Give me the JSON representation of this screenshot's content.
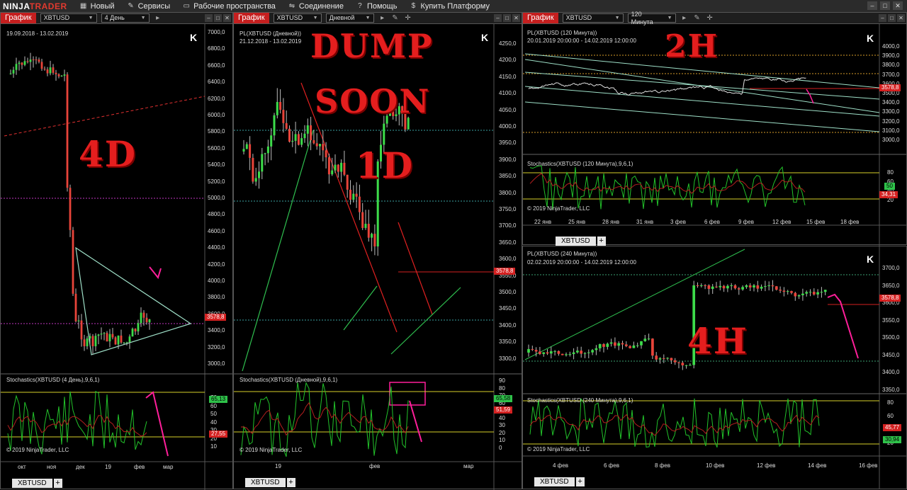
{
  "app": {
    "logo_prefix": "NINJA",
    "logo_suffix": "TRADER",
    "menu": [
      {
        "label": "Новый",
        "icon": "new-icon"
      },
      {
        "label": "Сервисы",
        "icon": "tools-icon"
      },
      {
        "label": "Рабочие пространства",
        "icon": "workspace-icon"
      },
      {
        "label": "Соединение",
        "icon": "connection-icon"
      },
      {
        "label": "Помощь",
        "icon": "help-icon"
      },
      {
        "label": "Купить Платформу",
        "icon": "dollar-icon"
      }
    ]
  },
  "panels": {
    "p4d": {
      "tab": "График",
      "instrument": "XBTUSD",
      "interval": "4 День",
      "range": "19.09.2018 - 13.02.2019",
      "price_ticks": [
        "7000,0",
        "6800,0",
        "6600,0",
        "6400,0",
        "6200,0",
        "6000,0",
        "5800,0",
        "5600,0",
        "5400,0",
        "5200,0",
        "5000,0",
        "4800,0",
        "4600,0",
        "4400,0",
        "4200,0",
        "4000,0",
        "3800,0",
        "3600,0",
        "3400,0",
        "3200,0",
        "3000,0"
      ],
      "last_price": "3578,8",
      "stoch_title": "Stochastics(XBTUSD (4 День),9,6,1)",
      "stoch_ticks": [
        "70",
        "60",
        "50",
        "40",
        "30",
        "20",
        "10"
      ],
      "stoch_k": "65,13",
      "stoch_d": "27,55",
      "copyright": "© 2019 NinjaTrader, LLC",
      "time_ticks": [
        "окт",
        "ноя",
        "дек",
        "19",
        "фев",
        "мар"
      ],
      "annotation": "4D",
      "bottom_tab": "XBTUSD"
    },
    "p1d": {
      "tab": "График",
      "instrument": "XBTUSD",
      "interval": "Дневной",
      "title": "PL(XBTUSD (Дневной))",
      "range": "21.12.2018 - 13.02.2019",
      "price_ticks": [
        "4250,0",
        "4200,0",
        "4150,0",
        "4100,0",
        "4050,0",
        "4000,0",
        "3950,0",
        "3900,0",
        "3850,0",
        "3800,0",
        "3750,0",
        "3700,0",
        "3650,0",
        "3600,0",
        "3550,0",
        "3500,0",
        "3450,0",
        "3400,0",
        "3350,0",
        "3300,0"
      ],
      "last_price": "3578,8",
      "stoch_title": "Stochastics(XBTUSD (Дневной),9,6,1)",
      "stoch_ticks": [
        "90",
        "80",
        "70",
        "60",
        "50",
        "40",
        "30",
        "20",
        "10",
        "0"
      ],
      "stoch_k": "65,58",
      "stoch_d": "51,59",
      "copyright": "© 2019 NinjaTrader, LLC",
      "time_ticks": [
        "19",
        "фев",
        "мар"
      ],
      "annotation_lines": [
        "DUMP",
        "SOON",
        "1D"
      ],
      "bottom_tab": "XBTUSD"
    },
    "p2h": {
      "tab": "График",
      "instrument": "XBTUSD",
      "interval": "120 Минута",
      "title": "PL(XBTUSD (120 Минута))",
      "range": "20.01.2019 20:00:00 - 14.02.2019 12:00:00",
      "price_ticks": [
        "4000,0",
        "3900,0",
        "3800,0",
        "3700,0",
        "3600,0",
        "3500,0",
        "3400,0",
        "3300,0",
        "3200,0",
        "3100,0",
        "3000,0"
      ],
      "last_price": "3578,8",
      "stoch_title": "Stochastics(XBTUSD (120 Минута),9,6,1)",
      "stoch_ticks": [
        "80",
        "60",
        "40",
        "20"
      ],
      "stoch_k": "50",
      "stoch_d": "34,31",
      "copyright": "© 2019 NinjaTrader, LLC",
      "time_ticks": [
        "22 янв",
        "25 янв",
        "28 янв",
        "31 янв",
        "3 фев",
        "6 фев",
        "9 фев",
        "12 фев",
        "15 фев",
        "18 фев"
      ],
      "annotation": "2H",
      "bottom_tab": "XBTUSD"
    },
    "p4h": {
      "title": "PL(XBTUSD (240 Минута))",
      "range": "02.02.2019 20:00:00 - 14.02.2019 12:00:00",
      "price_ticks": [
        "3700,0",
        "3650,0",
        "3600,0",
        "3550,0",
        "3500,0",
        "3450,0",
        "3400,0",
        "3350,0"
      ],
      "last_price": "3578,8",
      "stoch_title": "Stochastics(XBTUSD (240 Минута),9,6,1)",
      "stoch_ticks": [
        "80",
        "60",
        "40",
        "20"
      ],
      "stoch_k": "30,94",
      "stoch_d": "45,77",
      "copyright": "© 2019 NinjaTrader, LLC",
      "time_ticks": [
        "4 фев",
        "6 фев",
        "8 фев",
        "10 фев",
        "12 фев",
        "14 фев",
        "16 фев"
      ],
      "annotation": "4H",
      "bottom_tab": "XBTUSD"
    }
  },
  "colors": {
    "up": "#3ddc4a",
    "down": "#e8443a",
    "accent_red": "#c51f1f",
    "trend_green": "#2fbf4f",
    "trend_red": "#e02020",
    "cyan_line": "#9fe0c8",
    "magenta": "#ff1f9a",
    "stoch_k": "#22c22a",
    "stoch_d": "#b51f1f"
  }
}
